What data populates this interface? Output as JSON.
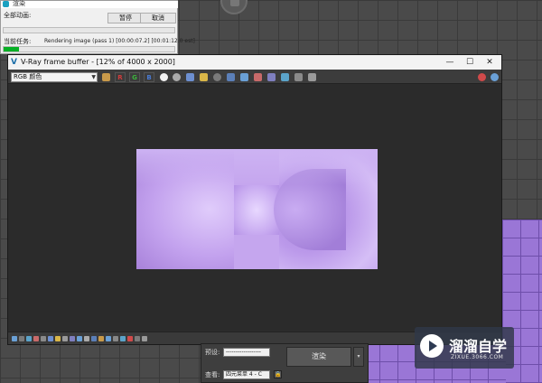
{
  "progress_dialog": {
    "title": "渲染",
    "all_animations_label": "全部动画:",
    "pause_label": "暂停",
    "cancel_label": "取消",
    "current_task_label": "当前任务:",
    "current_task_status": "Rendering image (pass 1) [00:00:07.2] [00:01:12.0 est]",
    "all_progress": 0.0,
    "current_progress": 0.09,
    "progress_color": "#06b025"
  },
  "frame_buffer": {
    "icon": "V",
    "title": "V-Ray frame buffer - [12% of 4000 x 2000]",
    "window_controls": {
      "minimize": "—",
      "maximize": "☐",
      "close": "✕"
    },
    "channel_select": "RGB 颜色",
    "toolbar": {
      "r_label": "R",
      "g_label": "G",
      "b_label": "B"
    },
    "accent_red": "#d23c3c",
    "accent_green": "#3cb43c",
    "accent_blue": "#4a7bd4"
  },
  "render_panel": {
    "preset_label": "预设:",
    "preset_value": "------------------",
    "view_label": "查看:",
    "view_value": "四元菜单 4 - C",
    "render_label": "渲染"
  },
  "watermark": {
    "name": "溜溜自学",
    "url": "ZIXUE.3066.COM"
  },
  "colors": {
    "render_purple": "#c5a6ee",
    "viewport_purple": "#9a76d6"
  }
}
